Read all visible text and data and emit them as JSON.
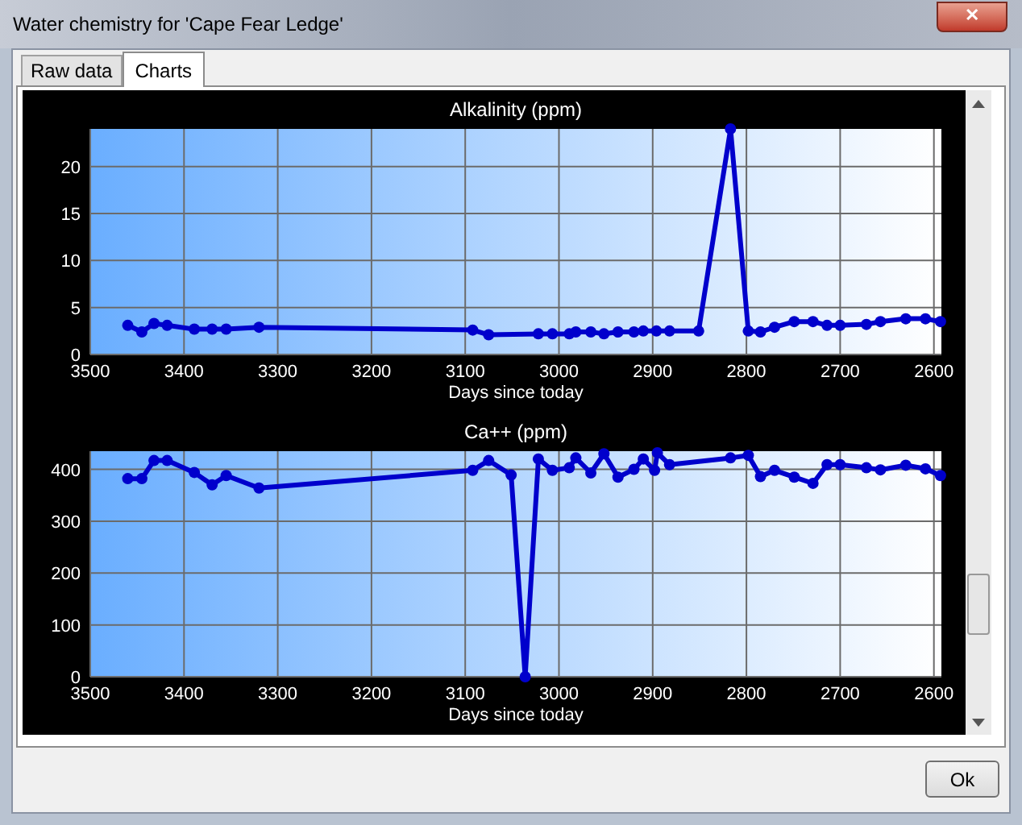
{
  "window": {
    "title": "Water chemistry for 'Cape Fear Ledge'",
    "close_label": "✕"
  },
  "tabs": [
    {
      "label": "Raw data",
      "selected": false
    },
    {
      "label": "Charts",
      "selected": true
    }
  ],
  "charts": [
    {
      "chart_data": {
        "type": "line",
        "title": "Alkalinity (ppm)",
        "xlabel": "Days since today",
        "x": [
          3460,
          3445,
          3432,
          3418,
          3389,
          3370,
          3355,
          3320,
          3092,
          3075,
          3022,
          3007,
          2989,
          2982,
          2966,
          2952,
          2937,
          2920,
          2910,
          2896,
          2882,
          2851,
          2817,
          2798,
          2785,
          2770,
          2749,
          2729,
          2714,
          2700,
          2672,
          2657,
          2630,
          2609,
          2593
        ],
        "series": [
          {
            "color": "#0000cc",
            "marker": true,
            "values": [
              3.1,
              2.4,
              3.3,
              3.1,
              2.7,
              2.7,
              2.7,
              2.9,
              2.6,
              2.1,
              2.2,
              2.2,
              2.2,
              2.4,
              2.4,
              2.2,
              2.4,
              2.4,
              2.5,
              2.5,
              2.5,
              2.5,
              24,
              2.5,
              2.4,
              2.9,
              3.5,
              3.5,
              3.1,
              3.1,
              3.2,
              3.5,
              3.8,
              3.8,
              3.5
            ]
          }
        ],
        "xlim": [
          3500,
          2592
        ],
        "grid": true,
        "ylim": [
          0,
          24
        ],
        "xticks": [
          3500,
          3400,
          3300,
          3200,
          3100,
          3000,
          2900,
          2800,
          2700,
          2600
        ],
        "yticks": [
          0,
          5,
          10,
          15,
          20
        ]
      }
    },
    {
      "chart_data": {
        "type": "line",
        "title": "Ca++ (ppm)",
        "xlabel": "Days since today",
        "x": [
          3460,
          3445,
          3432,
          3418,
          3389,
          3370,
          3355,
          3320,
          3092,
          3075,
          3051,
          3036,
          3022,
          3007,
          2989,
          2982,
          2966,
          2952,
          2937,
          2920,
          2910,
          2898,
          2895,
          2882,
          2817,
          2798,
          2785,
          2770,
          2749,
          2729,
          2714,
          2700,
          2672,
          2657,
          2630,
          2609,
          2593
        ],
        "series": [
          {
            "color": "#0000cc",
            "marker": true,
            "values": [
              382,
              382,
              417,
              417,
              394,
              370,
              388,
              364,
              398,
              417,
              389,
              0,
              420,
              398,
              403,
              422,
              393,
              430,
              385,
              400,
              420,
              398,
              432,
              409,
              422,
              427,
              386,
              398,
              385,
              373,
              409,
              409,
              403,
              399,
              408,
              401,
              388
            ]
          }
        ],
        "xlim": [
          3500,
          2592
        ],
        "grid": true,
        "ylim": [
          0,
          435
        ],
        "xticks": [
          3500,
          3400,
          3300,
          3200,
          3100,
          3000,
          2900,
          2800,
          2700,
          2600
        ],
        "yticks": [
          0,
          100,
          200,
          300,
          400
        ]
      }
    }
  ],
  "buttons": [
    {
      "label": "Ok"
    }
  ]
}
